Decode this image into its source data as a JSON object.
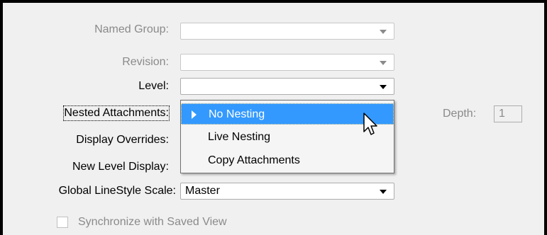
{
  "labels": {
    "named_group": "Named Group:",
    "revision": "Revision:",
    "level": "Level:",
    "nested_attachments": "Nested Attachments:",
    "display_overrides": "Display Overrides:",
    "new_level_display": "New Level Display:",
    "global_linestyle_scale": "Global LineStyle Scale:",
    "depth": "Depth:"
  },
  "fields": {
    "named_group": "",
    "revision": "",
    "level": "",
    "depth": "1",
    "global_linestyle_scale": "Master"
  },
  "nested_dropdown": {
    "options": [
      "No Nesting",
      "Live Nesting",
      "Copy Attachments"
    ],
    "selected": "No Nesting"
  },
  "checkbox": {
    "label": "Synchronize with Saved View",
    "checked": false,
    "enabled": false
  },
  "colors": {
    "highlight": "#3399ff",
    "disabled_text": "#8a8a8a",
    "dialog_bg": "#f0f0f0"
  },
  "icons": {
    "cursor": "arrow-pointer-icon",
    "dropdown": "chevron-down-icon",
    "selected_marker": "triangle-right-icon"
  }
}
